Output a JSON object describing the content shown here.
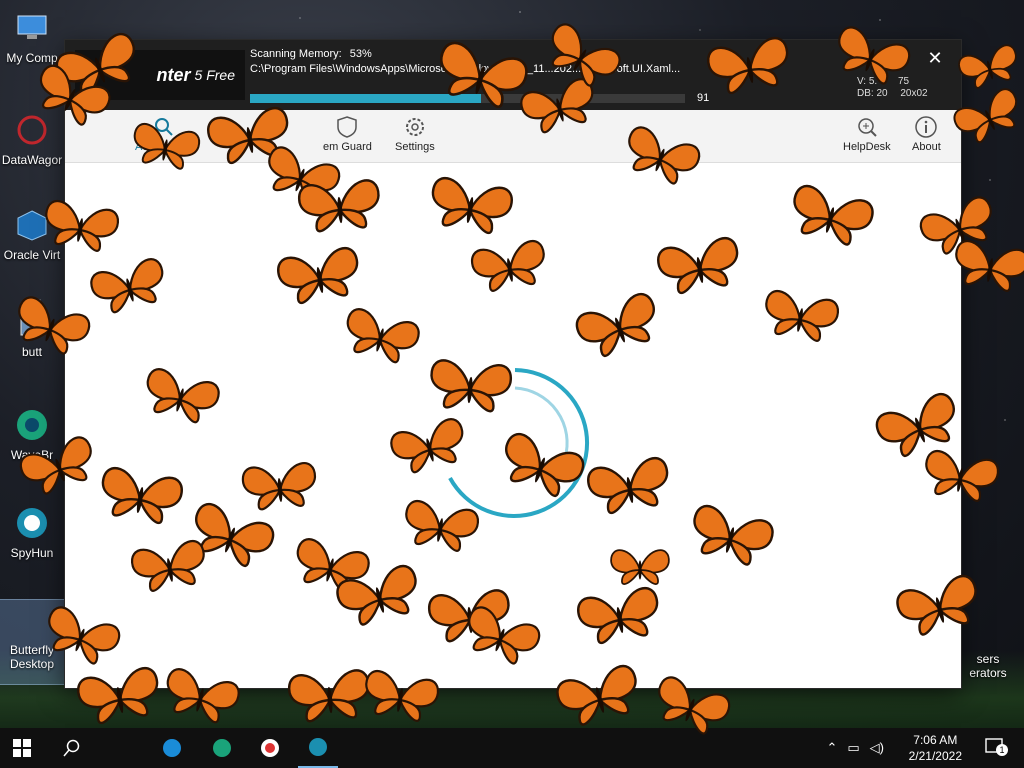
{
  "desktop": {
    "icons": [
      {
        "label": "My Comp",
        "icon": "computer-icon"
      },
      {
        "label": "DataWagor",
        "icon": "datawagor-icon"
      },
      {
        "label": "Oracle Virt",
        "icon": "virtualbox-icon"
      },
      {
        "label": "butt",
        "icon": "installer-icon"
      },
      {
        "label": "WaveBr",
        "icon": "wavebrowser-icon"
      },
      {
        "label": "SpyHun",
        "icon": "spyhunter-icon"
      },
      {
        "label": "Butterfly Desktop",
        "icon": "butterfly-icon"
      },
      {
        "label": "sers erators",
        "icon": "file-icon"
      }
    ]
  },
  "app": {
    "brand_name": "nter",
    "brand_version": "5 Free",
    "scan_label": "Scanning Memory:",
    "scan_percent": "53%",
    "scan_progress": 0.53,
    "scan_path": "C:\\Program Files\\WindowsApps\\Microsoft.WindowsStore_11...202...\\Microsoft.UI.Xaml...",
    "scan_count": "91",
    "version_line": "V: 5.",
    "version_suffix": "75",
    "db_line": "DB: 20",
    "db_suffix": "20x02",
    "close": "✕"
  },
  "toolbar": {
    "active_scan": "Active Scan",
    "system_guard": "em Guard",
    "settings": "Settings",
    "helpdesk": "HelpDesk",
    "about": "About"
  },
  "taskbar": {
    "time": "7:06 AM",
    "date": "2/21/2022",
    "notifications": "1"
  },
  "colors": {
    "accent": "#2aa7c4",
    "butterfly": "#e8741a"
  }
}
